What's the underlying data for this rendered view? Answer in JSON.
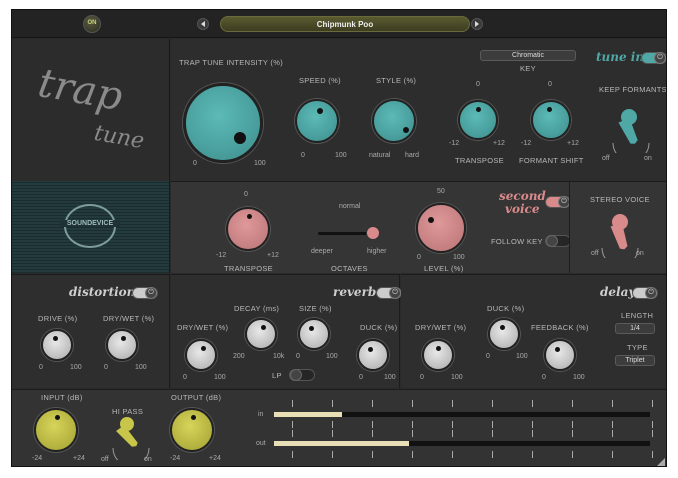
{
  "topbar": {
    "on_label": "ON",
    "preset_name": "Chipmunk Poo",
    "prev_icon": "triangle-left",
    "next_icon": "triangle-right"
  },
  "logo": {
    "line1": "trap",
    "line2": "tune",
    "brand": "SOUNDEVICE"
  },
  "tune": {
    "intensity_label": "TRAP TUNE INTENSITY (%)",
    "intensity_min": "0",
    "intensity_max": "100",
    "speed_label": "SPEED (%)",
    "speed_min": "0",
    "speed_max": "100",
    "style_label": "STYLE (%)",
    "style_min": "natural",
    "style_max": "hard",
    "key_value": "Chromatic",
    "key_label": "KEY",
    "transpose_label": "TRANSPOSE",
    "transpose_top": "0",
    "transpose_min": "-12",
    "transpose_max": "+12",
    "formant_label": "FORMANT SHIFT",
    "formant_top": "0",
    "formant_min": "-12",
    "formant_max": "+12",
    "tune_in_label": "tune in",
    "keep_formants_label": "KEEP FORMANTS",
    "kf_off": "off",
    "kf_on": "on"
  },
  "voice2": {
    "transpose_top": "0",
    "transpose_min": "-12",
    "transpose_max": "+12",
    "transpose_label": "TRANSPOSE",
    "octaves_top": "normal",
    "octaves_min": "deeper",
    "octaves_max": "higher",
    "octaves_label": "OCTAVES",
    "level_top": "50",
    "level_min": "0",
    "level_max": "100",
    "level_label": "LEVEL (%)",
    "title_line1": "second",
    "title_line2": "voice",
    "follow_key_label": "FOLLOW KEY",
    "stereo_label": "STEREO VOICE",
    "stereo_off": "off",
    "stereo_on": "on"
  },
  "distortion": {
    "title": "distortion",
    "drive_label": "DRIVE (%)",
    "drywet_label": "DRY/WET (%)",
    "min": "0",
    "max": "100"
  },
  "reverb": {
    "title": "reverb",
    "drywet_label": "DRY/WET (%)",
    "decay_label": "DECAY (ms)",
    "decay_min": "200",
    "decay_max": "10k",
    "size_label": "SIZE (%)",
    "duck_label": "DUCK (%)",
    "lp_label": "LP",
    "min": "0",
    "max": "100"
  },
  "delay": {
    "title": "delay",
    "drywet_label": "DRY/WET (%)",
    "duck_label": "DUCK (%)",
    "feedback_label": "FEEDBACK (%)",
    "length_label": "LENGTH",
    "length_value": "1/4",
    "type_label": "TYPE",
    "type_value": "Triplet",
    "min": "0",
    "max": "100"
  },
  "io": {
    "input_label": "INPUT (dB)",
    "input_min": "-24",
    "input_max": "+24",
    "hipass_label": "HI PASS",
    "hp_off": "off",
    "hp_on": "on",
    "output_label": "OUTPUT (dB)",
    "output_min": "-24",
    "output_max": "+24",
    "meter_in_label": "in",
    "meter_out_label": "out",
    "meter_in_level": 0.18,
    "meter_out_level": 0.36
  },
  "colors": {
    "teal": "#4fa8a6",
    "pink": "#d98b8c",
    "yellow": "#c7c54a",
    "cream": "#e8dfb6"
  }
}
